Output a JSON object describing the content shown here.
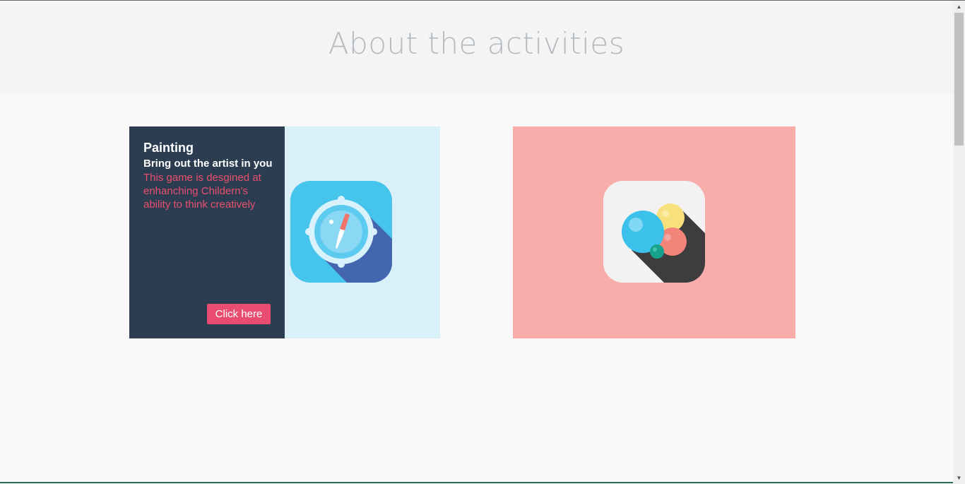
{
  "header": {
    "title": "About the activities"
  },
  "cards": [
    {
      "title": "Painting",
      "subtitle": "Bring out the artist in you",
      "description": "This game is desgined at enhanching Childern's ability to think creatively",
      "button_label": "Click here",
      "icon": "compass-icon",
      "panel_color": "#2d3d51",
      "background_color": "#daf0f8"
    },
    {
      "icon": "bubbles-icon",
      "background_color": "#f8adab"
    }
  ],
  "colors": {
    "accent": "#e84c6e"
  }
}
